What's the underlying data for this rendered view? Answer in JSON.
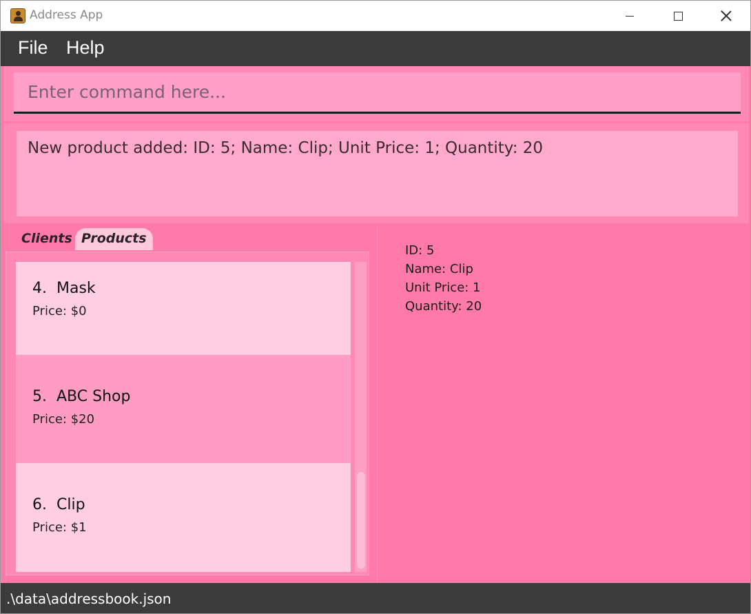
{
  "window": {
    "title": "Address App"
  },
  "menu": {
    "file": "File",
    "help": "Help"
  },
  "command": {
    "placeholder": "Enter command here..."
  },
  "result": {
    "message": "New product added: ID: 5; Name: Clip; Unit Price: 1; Quantity: 20"
  },
  "tabs": [
    {
      "label": "Clients",
      "selected": false
    },
    {
      "label": "Products",
      "selected": true
    }
  ],
  "products": [
    {
      "index": "4.",
      "name": "Mask",
      "price": "Price: $0"
    },
    {
      "index": "5.",
      "name": "ABC Shop",
      "price": "Price: $20"
    },
    {
      "index": "6.",
      "name": "Clip",
      "price": "Price: $1"
    }
  ],
  "detail": {
    "id": "ID: 5",
    "name": "Name: Clip",
    "unit_price": "Unit Price: 1",
    "quantity": "Quantity: 20"
  },
  "status": {
    "path": ".\\data\\addressbook.json"
  },
  "colors": {
    "accent": "#ff7aa8",
    "card_light": "#ffcee2",
    "card_selected": "#ff9cc4",
    "bar_dark": "#3b3b3b"
  },
  "icons": [
    "app-icon",
    "minimize-icon",
    "maximize-icon",
    "close-icon"
  ]
}
